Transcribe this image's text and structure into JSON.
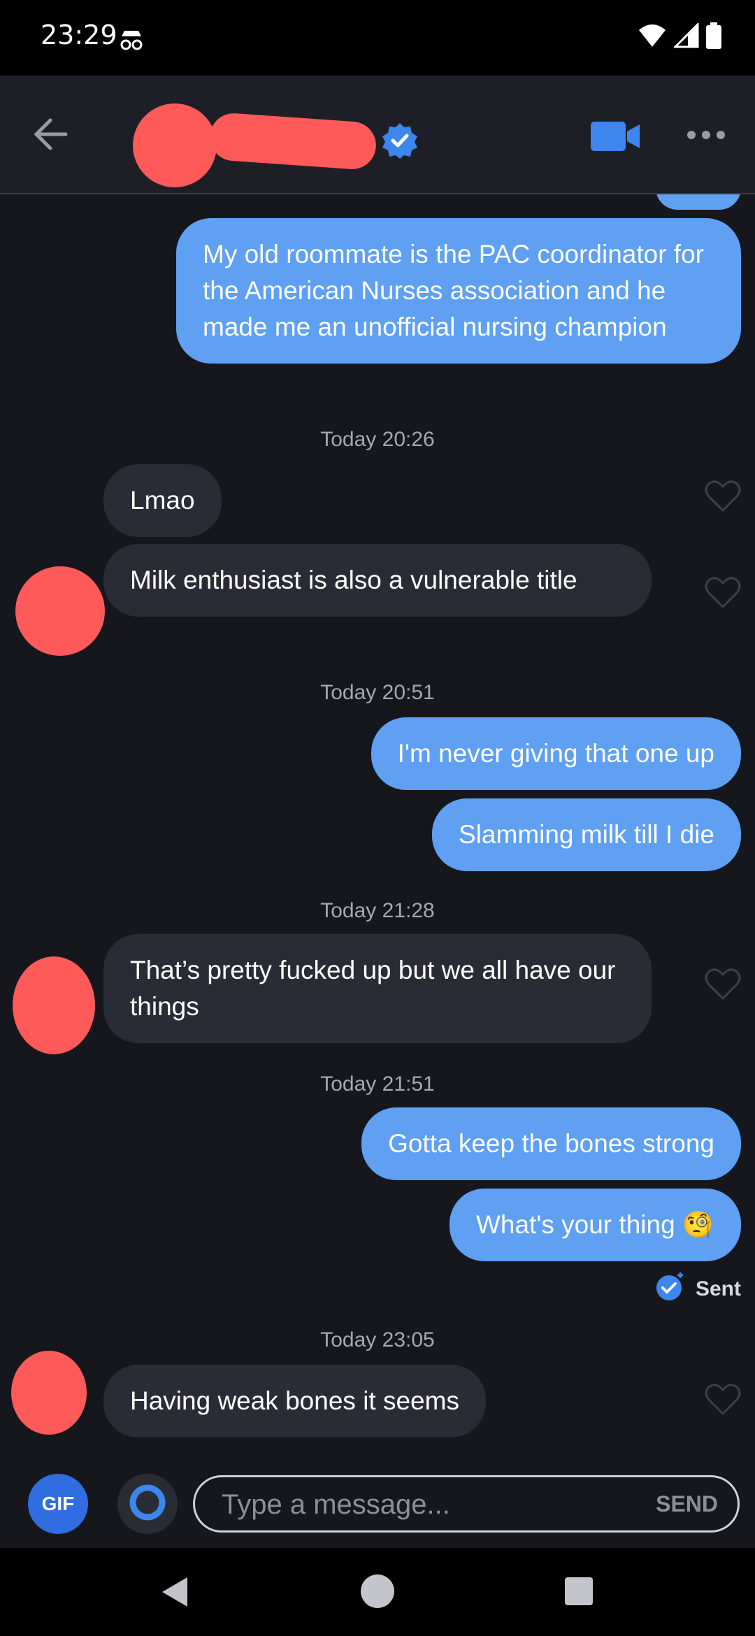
{
  "status": {
    "time": "23:29"
  },
  "header": {
    "verified": true
  },
  "messages": {
    "m1": "My old roommate is the PAC coordinator for the American Nurses association and he made me an unofficial nursing champion",
    "ts1_day": "Today",
    "ts1_time": "20:26",
    "m2": "Lmao",
    "m3": "Milk enthusiast is also a vulnerable title",
    "ts2_day": "Today",
    "ts2_time": "20:51",
    "m4": "I'm never giving that one up",
    "m5": "Slamming milk till I die",
    "ts3_day": "Today",
    "ts3_time": "21:28",
    "m6": "That’s pretty fucked up but we all have our things",
    "ts4_day": "Today",
    "ts4_time": "21:51",
    "m7": "Gotta keep the bones strong",
    "m8": "What's your thing 🧐",
    "sent_label": "Sent",
    "ts5_day": "Today",
    "ts5_time": "23:05",
    "m9": "Having weak bones it seems"
  },
  "input": {
    "gif_label": "GIF",
    "placeholder": "Type a message...",
    "send_label": "SEND"
  },
  "colors": {
    "outgoing": "#5fa0f3",
    "incoming": "#2a2c35",
    "background": "#16171d",
    "accent": "#2f6de0",
    "redaction": "#ff5a5a"
  },
  "icons": [
    "incognito-icon",
    "wifi-icon",
    "signal-icon",
    "battery-icon",
    "back-arrow-icon",
    "verified-badge-icon",
    "video-call-icon",
    "more-icon",
    "heart-icon",
    "sent-check-icon",
    "loop-icon",
    "nav-back-icon",
    "nav-home-icon",
    "nav-recents-icon"
  ]
}
